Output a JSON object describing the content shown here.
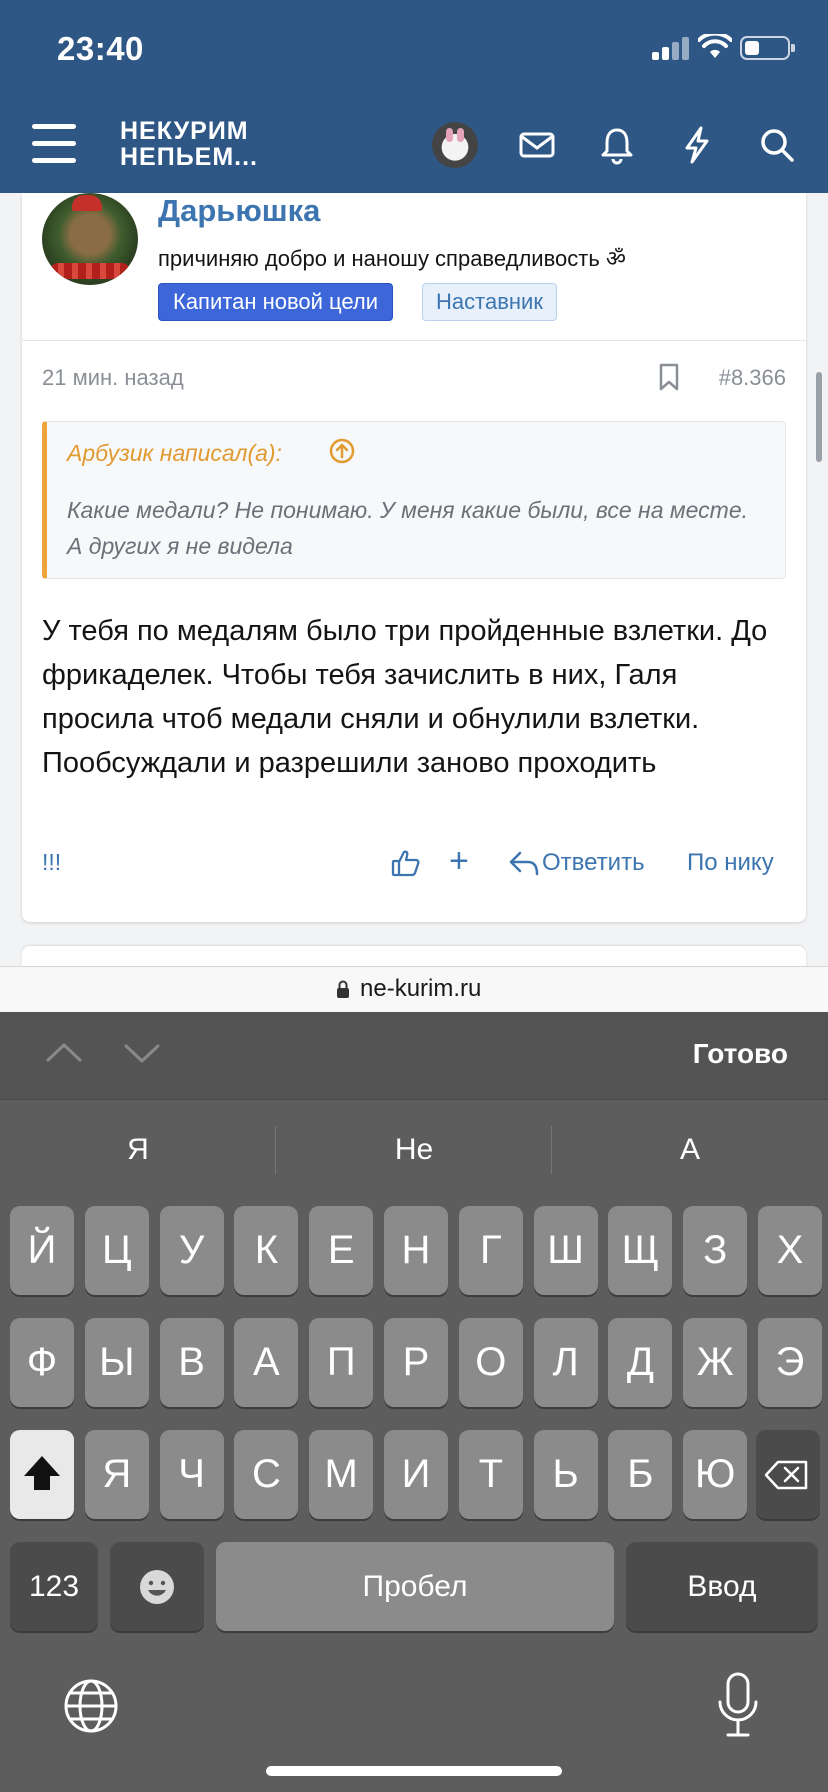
{
  "status_bar": {
    "time": "23:40"
  },
  "header": {
    "logo_line1": "НЕКУРИМ",
    "logo_line2": "НЕПЬЕМ...",
    "icons": [
      "menu-icon",
      "avatar",
      "mail-icon",
      "bell-icon",
      "lightning-icon",
      "search-icon"
    ]
  },
  "post": {
    "username": "Дарьюшка",
    "user_title": "причиняю добро и наношу справедливость ॐ",
    "badges": [
      "Капитан новой цели",
      "Наставник"
    ],
    "time": "21 мин. назад",
    "number": "#8.366",
    "quote": {
      "author": "Арбузик написал(а):",
      "text": "Какие медали? Не понимаю. У меня какие были, все на месте. А других я не видела"
    },
    "body": "У тебя по медалям было три пройденные взлетки. До фрикаделек. Чтобы тебя зачислить в них, Галя просила чтоб медали сняли и обнулили взлетки. Пообсуждали и разрешили заново проходить",
    "footer": {
      "flags": "!!!",
      "plus": "+",
      "reply": "Ответить",
      "by_nick": "По нику"
    }
  },
  "browser": {
    "url": "ne-kurim.ru"
  },
  "keyboard": {
    "done": "Готово",
    "suggestions": [
      "Я",
      "Не",
      "А"
    ],
    "row1": [
      "Й",
      "Ц",
      "У",
      "К",
      "Е",
      "Н",
      "Г",
      "Ш",
      "Щ",
      "З",
      "Х"
    ],
    "row2": [
      "Ф",
      "Ы",
      "В",
      "А",
      "П",
      "Р",
      "О",
      "Л",
      "Д",
      "Ж",
      "Э"
    ],
    "row3": [
      "Я",
      "Ч",
      "С",
      "М",
      "И",
      "Т",
      "Ь",
      "Б",
      "Ю"
    ],
    "numbers_key": "123",
    "space_key": "Пробел",
    "enter_key": "Ввод"
  },
  "colors": {
    "header_bg": "#2e5786",
    "accent": "#3d75b0",
    "badge_primary": "#3d67d9",
    "quote_accent": "#eda43b"
  }
}
